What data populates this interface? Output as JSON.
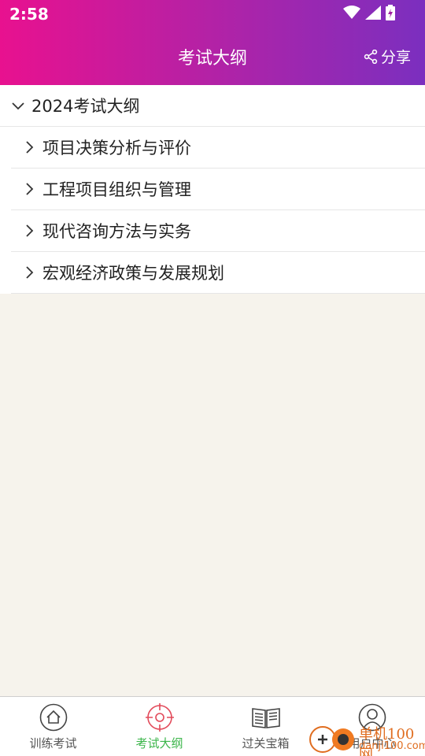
{
  "status_bar": {
    "time": "2:58"
  },
  "header": {
    "title": "考试大纲",
    "share_label": "分享"
  },
  "tree": {
    "root_label": "2024考试大纲",
    "items": [
      {
        "label": "项目决策分析与评价"
      },
      {
        "label": "工程项目组织与管理"
      },
      {
        "label": "现代咨询方法与实务"
      },
      {
        "label": "宏观经济政策与发展规划"
      }
    ]
  },
  "tabbar": {
    "tabs": [
      {
        "label": "训练考试",
        "icon": "home-icon",
        "active": false
      },
      {
        "label": "考试大纲",
        "icon": "target-icon",
        "active": true
      },
      {
        "label": "过关宝箱",
        "icon": "book-icon",
        "active": false
      },
      {
        "label": "用户中心",
        "icon": "user-icon",
        "active": false
      }
    ]
  },
  "watermark": {
    "text": "单机100网",
    "sub": "danji100.com"
  },
  "colors": {
    "header_start": "#e8118f",
    "header_end": "#7b2fbf",
    "active_tab": "#3bb54a",
    "background": "#f6f3ec"
  }
}
